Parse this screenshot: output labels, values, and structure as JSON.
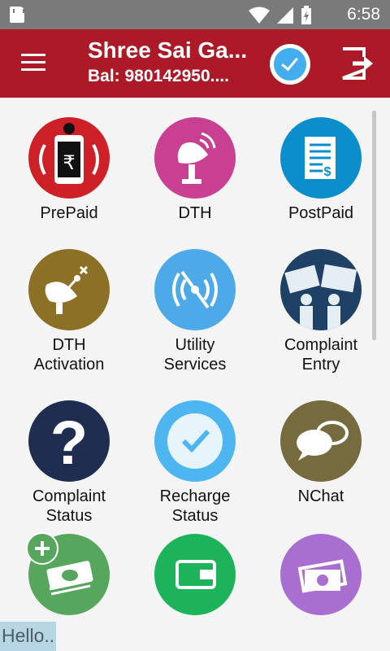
{
  "status_bar": {
    "time": "6:58",
    "icons": [
      "sd-card-icon",
      "wifi-icon",
      "signal-icon",
      "battery-icon"
    ]
  },
  "app_bar": {
    "title": "Shree Sai Ga...",
    "balance": "Bal: 980142950....",
    "icons": [
      "menu-icon",
      "verified-check-icon",
      "logout-icon"
    ]
  },
  "tiles": [
    {
      "label": "PrePaid",
      "icon": "prepaid-phone-icon",
      "color": "#ce2027"
    },
    {
      "label": "DTH",
      "icon": "satellite-dish-icon",
      "color": "#c94092"
    },
    {
      "label": "PostPaid",
      "icon": "bill-icon",
      "color": "#0c8ecd"
    },
    {
      "label": "DTH\nActivation",
      "icon": "dish-antenna-icon",
      "color": "#8b7026"
    },
    {
      "label": "Utility\nServices",
      "icon": "utility-signal-off-icon",
      "color": "#4da9e8"
    },
    {
      "label": "Complaint\nEntry",
      "icon": "protest-signs-icon",
      "color": "#1f4165"
    },
    {
      "label": "Complaint\nStatus",
      "icon": "question-icon",
      "color": "#1e2d50"
    },
    {
      "label": "Recharge\nStatus",
      "icon": "check-circle-icon",
      "color": "#4db5ef"
    },
    {
      "label": "NChat",
      "icon": "chat-bubbles-icon",
      "color": "#756b3e"
    },
    {
      "label": "",
      "icon": "add-money-icon",
      "color": "#57a65d"
    },
    {
      "label": "",
      "icon": "wallet-icon",
      "color": "#1cb35b"
    },
    {
      "label": "",
      "icon": "cash-icon",
      "color": "#a96fd0"
    }
  ],
  "toast": "Hello.."
}
